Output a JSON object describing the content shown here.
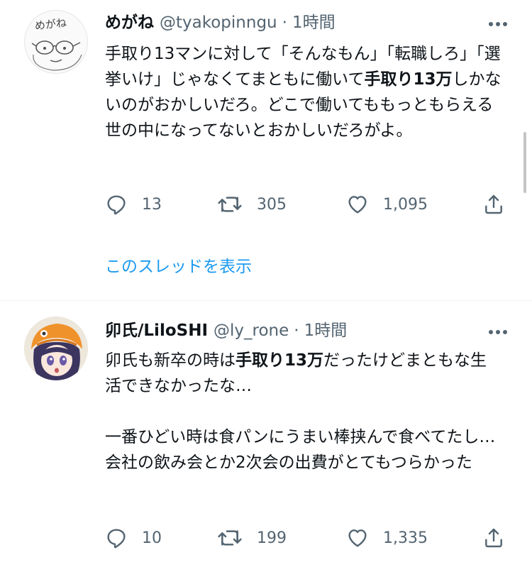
{
  "tweets": [
    {
      "name": "めがね",
      "handle": "@tyakopinngu",
      "dot": "·",
      "time": "1時間",
      "avatar_text": "めがね",
      "body_segments": [
        {
          "text": "手取り13マンに対して「そんなもん」「転職しろ」「選挙いけ」じゃなくてまともに働いて",
          "bold": false
        },
        {
          "text": "手取り13万",
          "bold": true
        },
        {
          "text": "しかないのがおかしいだろ。どこで働いてももっともらえる世の中になってないとおかしいだろがよ。",
          "bold": false
        }
      ],
      "replies": "13",
      "retweets": "305",
      "likes": "1,095"
    },
    {
      "name": "卯氏/LiloSHI",
      "handle": "@ly_rone",
      "dot": "·",
      "time": "1時間",
      "body_segments": [
        {
          "text": "卯氏も新卒の時は",
          "bold": false
        },
        {
          "text": "手取り13万",
          "bold": true
        },
        {
          "text": "だったけどまともな生活できなかったな…\n\n一番ひどい時は食パンにうまい棒挟んで食べてたし…会社の飲み会とか2次会の出費がとてもつらかった",
          "bold": false
        }
      ],
      "replies": "10",
      "retweets": "199",
      "likes": "1,335"
    }
  ],
  "show_thread_label": "このスレッドを表示",
  "icons": {
    "more": "more-icon",
    "reply": "reply-icon",
    "retweet": "retweet-icon",
    "like": "like-icon",
    "share": "share-icon"
  },
  "colors": {
    "link": "#1d9bf0",
    "secondary_text": "#536471",
    "text": "#0f1419",
    "divider": "#eff3f4"
  }
}
